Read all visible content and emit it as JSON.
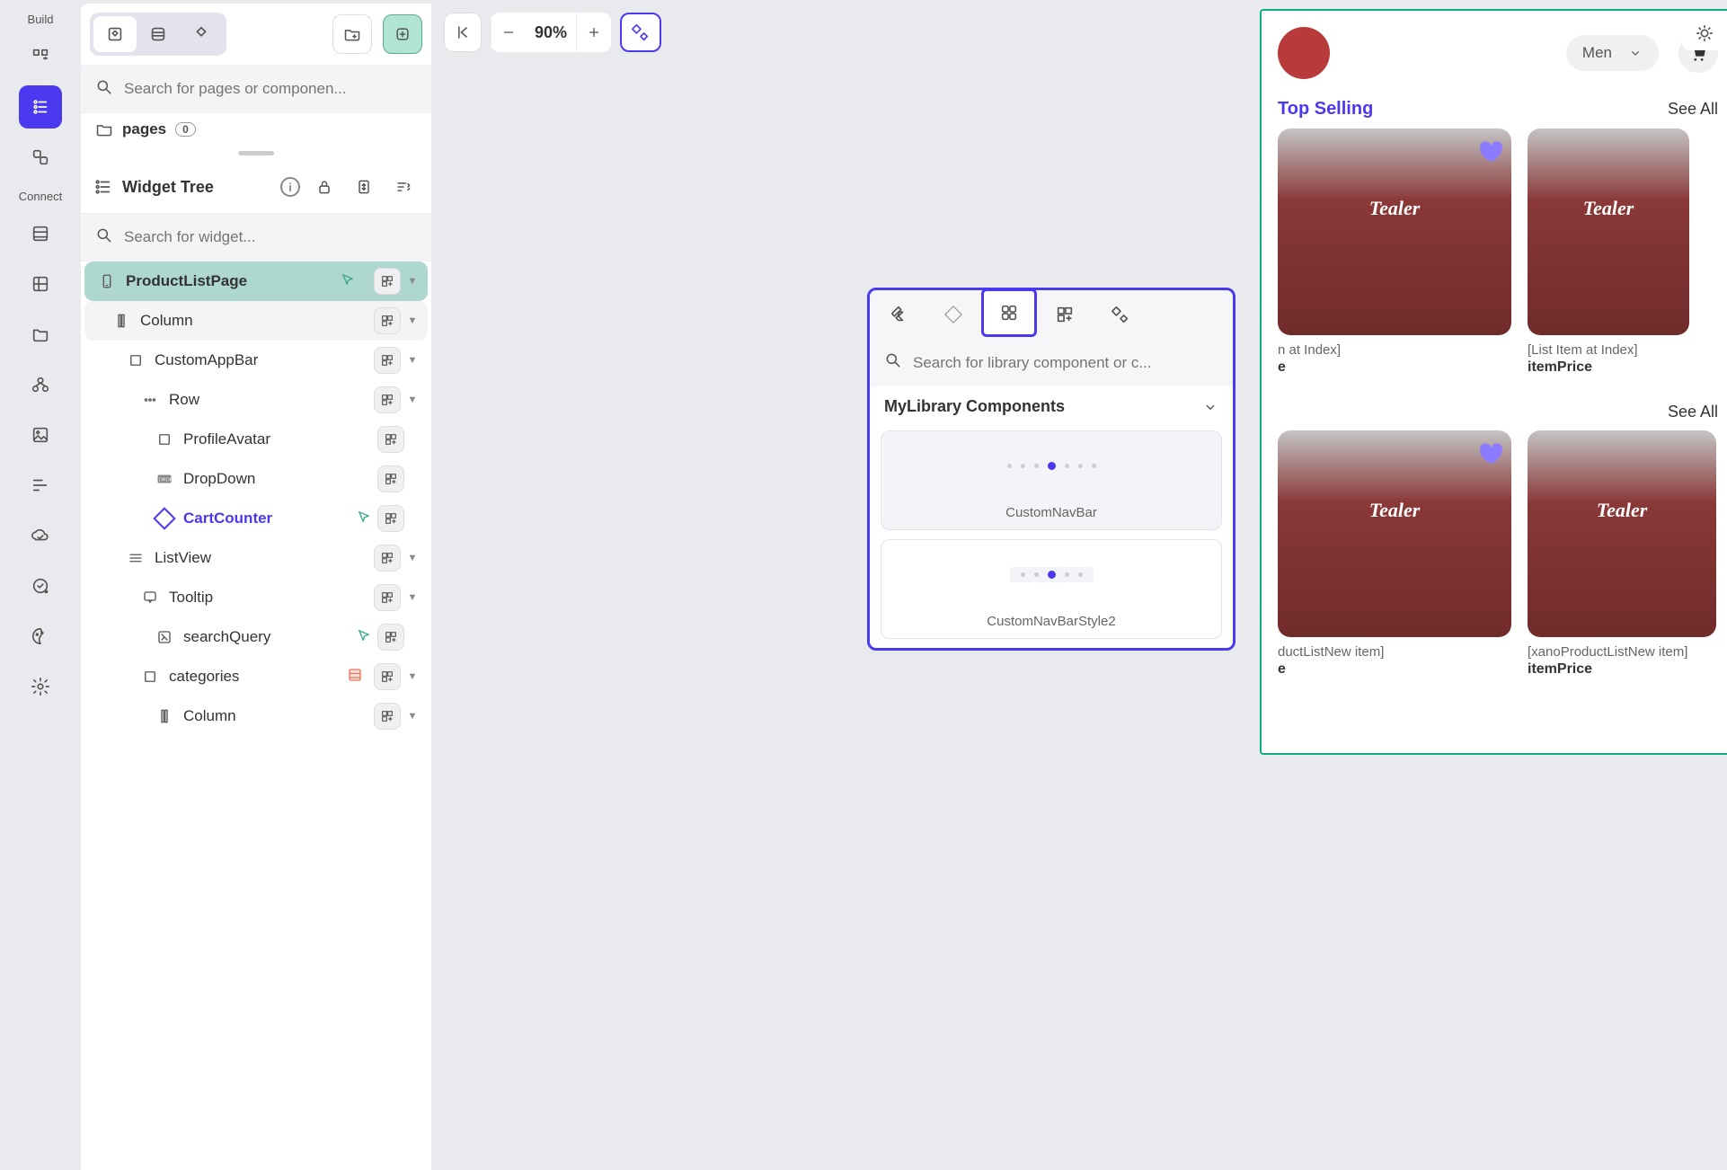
{
  "rail": {
    "build_label": "Build",
    "connect_label": "Connect"
  },
  "panel": {
    "search_placeholder": "Search for pages or componen...",
    "folder_name": "pages",
    "folder_count": "0",
    "widget_tree_title": "Widget Tree",
    "widget_search_placeholder": "Search for widget...",
    "page_name": "ProductListPage"
  },
  "tree": [
    {
      "label": "Column",
      "indent": 1,
      "icon": "column",
      "hover": true
    },
    {
      "label": "CustomAppBar",
      "indent": 2,
      "icon": "box"
    },
    {
      "label": "Row",
      "indent": 3,
      "icon": "row"
    },
    {
      "label": "ProfileAvatar",
      "indent": 4,
      "icon": "box"
    },
    {
      "label": "DropDown",
      "indent": 4,
      "icon": "dropdown"
    },
    {
      "label": "CartCounter",
      "indent": 4,
      "icon": "diamond",
      "highlighted": true,
      "arrow": true
    },
    {
      "label": "ListView",
      "indent": 2,
      "icon": "list"
    },
    {
      "label": "Tooltip",
      "indent": 3,
      "icon": "tooltip"
    },
    {
      "label": "searchQuery",
      "indent": 4,
      "icon": "query",
      "arrow": true
    },
    {
      "label": "categories",
      "indent": 3,
      "icon": "box",
      "db": true
    },
    {
      "label": "Column",
      "indent": 4,
      "icon": "column"
    }
  ],
  "toolbar": {
    "zoom": "90%"
  },
  "preview": {
    "dropdown": "Men",
    "section1_title": "Top Selling",
    "section2_title": "",
    "see_all": "See All",
    "logo": "Tealer",
    "card1_text": "n at Index]",
    "card2_text": "[List Item at Index]",
    "card3_text": "ductListNew item]",
    "card4_text": "[xanoProductListNew item]",
    "price": "itemPrice",
    "price2": "e"
  },
  "popup": {
    "search_placeholder": "Search for library component or c...",
    "section_title": "MyLibrary Components",
    "comp1": "CustomNavBar",
    "comp2": "CustomNavBarStyle2"
  }
}
